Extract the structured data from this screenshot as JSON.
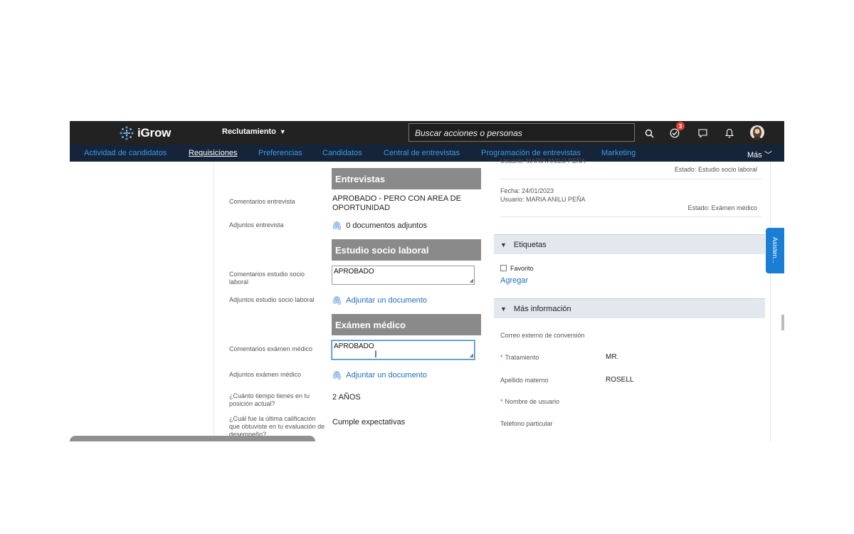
{
  "app": {
    "logo_text": "iGrow",
    "module": "Reclutamiento",
    "search_placeholder": "Buscar acciones o personas",
    "notifications_badge": "3"
  },
  "nav": {
    "items": [
      "Actividad de candidatos",
      "Requisiciones",
      "Preferencias",
      "Candidatos",
      "Central de entrevistas",
      "Programación de entrevistas",
      "Marketing"
    ],
    "active": "Requisiciones",
    "more": "Más"
  },
  "left": {
    "sec_entrevistas": "Entrevistas",
    "comentarios_entrevista_label": "Comentarios entrevista",
    "comentarios_entrevista_value": "APROBADO - PERO CON AREA DE OPORTUNIDAD",
    "adjuntos_entrevista_label": "Adjuntos entrevista",
    "adjuntos_entrevista_value": "0 documentos adjuntos",
    "sec_estudio": "Estudio socio laboral",
    "comentarios_estudio_label": "Comentarios estudio socio laboral",
    "comentarios_estudio_value": "APROBADO",
    "adjuntos_estudio_label": "Adjuntos estudio socio laboral",
    "adjuntar_1": "Adjuntar un documento",
    "sec_examen": "Exámen médico",
    "comentarios_examen_label": "Comentarios exámen médico",
    "comentarios_examen_value": "APROBADO",
    "adjuntos_examen_label": "Adjuntos exámen médico",
    "adjuntar_2": "Adjuntar un documento",
    "tiempo_label": "¿Cuánto tiempo tienes en tu posición actual?",
    "tiempo_value": "2 AÑOS",
    "calificacion_label": "¿Cuál fue la última calificación que obtuviste en tu evaluación de desempeño?",
    "calificacion_value": "Cumple expectativas"
  },
  "right": {
    "hist1_usuario": "Usuario: MARIA ANILU PEÑA",
    "hist1_estado": "Estado: Estudio socio laboral",
    "hist2_fecha": "Fecha: 24/01/2023",
    "hist2_usuario": "Usuario: MARIA ANILU PEÑA",
    "hist2_estado": "Estado: Exámen médico",
    "etiquetas": "Etiquetas",
    "favorito": "Favorito",
    "agregar": "Agregar",
    "mas_info": "Más información",
    "correo_label": "Correo externo de conversión",
    "tratamiento_label": "Tratamiento",
    "tratamiento_value": "MR.",
    "apellido_label": "Apellido materno",
    "apellido_value": "ROSELL",
    "nombre_usuario_label": "Nombre de usuario",
    "telefono_label": "Teléfono particular",
    "required_mark": "*"
  },
  "assistant_tab": "Asisten..."
}
